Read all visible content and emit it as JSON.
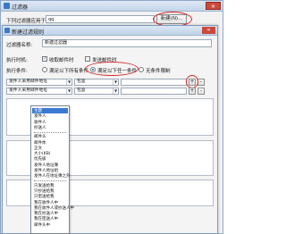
{
  "back_dialog": {
    "title": "过滤器",
    "close": "✕",
    "filter_label": "下列过滤器应用于:",
    "filter_value": "qq",
    "new_button": "新建(N)..."
  },
  "front_dialog": {
    "title": "新建过滤规则",
    "close": "✕",
    "name_label": "过滤器名称:",
    "name_value": "新建过滤器",
    "exec_label": "执行时机:",
    "exec_options": [
      {
        "label": "收取邮件时",
        "checked": true
      },
      {
        "label": "发送邮件时",
        "checked": false
      }
    ],
    "cond_label": "执行条件:",
    "cond_options": [
      {
        "label": "满足以下所有条件",
        "selected": false
      },
      {
        "label": "满足以下任一条件",
        "selected": true
      },
      {
        "label": "无条件限制",
        "selected": false
      }
    ],
    "rows": [
      {
        "field": "发件人采用邮件地址",
        "op": "包含",
        "value": ""
      },
      {
        "field": "发件人采用邮件地址",
        "op": "包含",
        "value": ""
      }
    ],
    "row_buttons": {
      "plus": "+",
      "minus": "-"
    }
  },
  "dropdown": {
    "groups": [
      [
        "主题",
        "发件人",
        "收件人",
        "抄送人"
      ],
      [
        "邮件头",
        "邮件体",
        "正文",
        "大小(KB)",
        "优先级",
        "发件人地址簿",
        "发件人地址组",
        "发件人在地址簿之外"
      ],
      [
        "只发送给我",
        "只抄送给我",
        "只密送给我",
        "我在收件人中",
        "我在收件人或抄送人中",
        "我在抄送人中",
        "我在密送人中",
        "邮件头中"
      ]
    ],
    "selected": "主题"
  },
  "colors": {
    "accent": "#3b7ad0",
    "highlight_ring": "#d62a2a",
    "close": "#c94a3d"
  }
}
